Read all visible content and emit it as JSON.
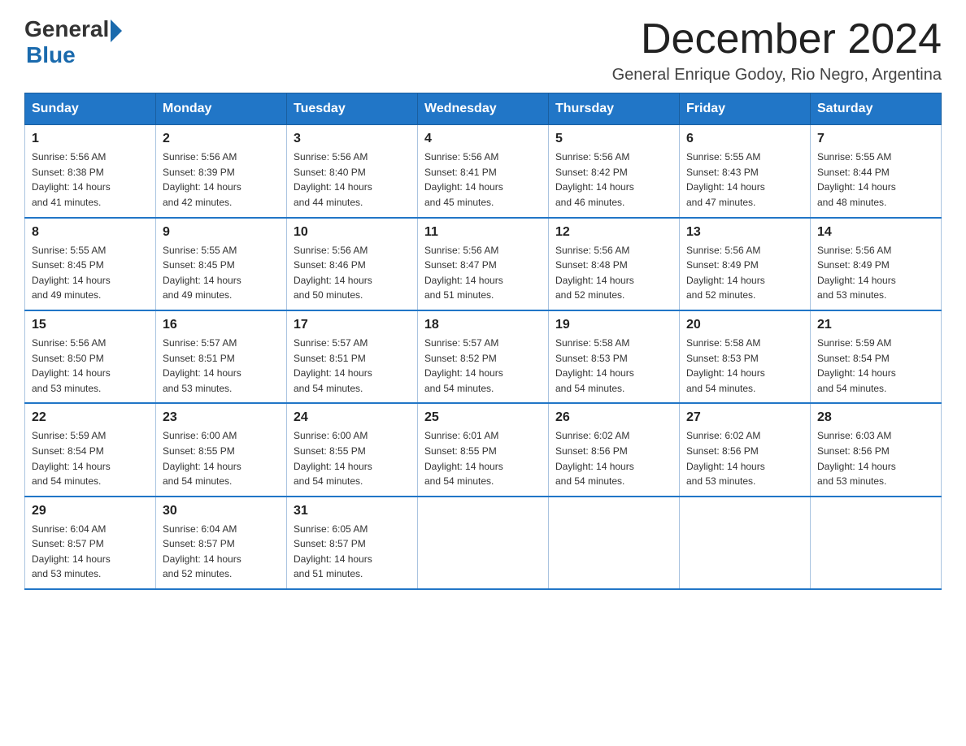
{
  "header": {
    "logo_general": "General",
    "logo_blue": "Blue",
    "month_title": "December 2024",
    "location": "General Enrique Godoy, Rio Negro, Argentina"
  },
  "columns": [
    "Sunday",
    "Monday",
    "Tuesday",
    "Wednesday",
    "Thursday",
    "Friday",
    "Saturday"
  ],
  "weeks": [
    [
      {
        "day": "1",
        "sunrise": "5:56 AM",
        "sunset": "8:38 PM",
        "daylight": "14 hours and 41 minutes."
      },
      {
        "day": "2",
        "sunrise": "5:56 AM",
        "sunset": "8:39 PM",
        "daylight": "14 hours and 42 minutes."
      },
      {
        "day": "3",
        "sunrise": "5:56 AM",
        "sunset": "8:40 PM",
        "daylight": "14 hours and 44 minutes."
      },
      {
        "day": "4",
        "sunrise": "5:56 AM",
        "sunset": "8:41 PM",
        "daylight": "14 hours and 45 minutes."
      },
      {
        "day": "5",
        "sunrise": "5:56 AM",
        "sunset": "8:42 PM",
        "daylight": "14 hours and 46 minutes."
      },
      {
        "day": "6",
        "sunrise": "5:55 AM",
        "sunset": "8:43 PM",
        "daylight": "14 hours and 47 minutes."
      },
      {
        "day": "7",
        "sunrise": "5:55 AM",
        "sunset": "8:44 PM",
        "daylight": "14 hours and 48 minutes."
      }
    ],
    [
      {
        "day": "8",
        "sunrise": "5:55 AM",
        "sunset": "8:45 PM",
        "daylight": "14 hours and 49 minutes."
      },
      {
        "day": "9",
        "sunrise": "5:55 AM",
        "sunset": "8:45 PM",
        "daylight": "14 hours and 49 minutes."
      },
      {
        "day": "10",
        "sunrise": "5:56 AM",
        "sunset": "8:46 PM",
        "daylight": "14 hours and 50 minutes."
      },
      {
        "day": "11",
        "sunrise": "5:56 AM",
        "sunset": "8:47 PM",
        "daylight": "14 hours and 51 minutes."
      },
      {
        "day": "12",
        "sunrise": "5:56 AM",
        "sunset": "8:48 PM",
        "daylight": "14 hours and 52 minutes."
      },
      {
        "day": "13",
        "sunrise": "5:56 AM",
        "sunset": "8:49 PM",
        "daylight": "14 hours and 52 minutes."
      },
      {
        "day": "14",
        "sunrise": "5:56 AM",
        "sunset": "8:49 PM",
        "daylight": "14 hours and 53 minutes."
      }
    ],
    [
      {
        "day": "15",
        "sunrise": "5:56 AM",
        "sunset": "8:50 PM",
        "daylight": "14 hours and 53 minutes."
      },
      {
        "day": "16",
        "sunrise": "5:57 AM",
        "sunset": "8:51 PM",
        "daylight": "14 hours and 53 minutes."
      },
      {
        "day": "17",
        "sunrise": "5:57 AM",
        "sunset": "8:51 PM",
        "daylight": "14 hours and 54 minutes."
      },
      {
        "day": "18",
        "sunrise": "5:57 AM",
        "sunset": "8:52 PM",
        "daylight": "14 hours and 54 minutes."
      },
      {
        "day": "19",
        "sunrise": "5:58 AM",
        "sunset": "8:53 PM",
        "daylight": "14 hours and 54 minutes."
      },
      {
        "day": "20",
        "sunrise": "5:58 AM",
        "sunset": "8:53 PM",
        "daylight": "14 hours and 54 minutes."
      },
      {
        "day": "21",
        "sunrise": "5:59 AM",
        "sunset": "8:54 PM",
        "daylight": "14 hours and 54 minutes."
      }
    ],
    [
      {
        "day": "22",
        "sunrise": "5:59 AM",
        "sunset": "8:54 PM",
        "daylight": "14 hours and 54 minutes."
      },
      {
        "day": "23",
        "sunrise": "6:00 AM",
        "sunset": "8:55 PM",
        "daylight": "14 hours and 54 minutes."
      },
      {
        "day": "24",
        "sunrise": "6:00 AM",
        "sunset": "8:55 PM",
        "daylight": "14 hours and 54 minutes."
      },
      {
        "day": "25",
        "sunrise": "6:01 AM",
        "sunset": "8:55 PM",
        "daylight": "14 hours and 54 minutes."
      },
      {
        "day": "26",
        "sunrise": "6:02 AM",
        "sunset": "8:56 PM",
        "daylight": "14 hours and 54 minutes."
      },
      {
        "day": "27",
        "sunrise": "6:02 AM",
        "sunset": "8:56 PM",
        "daylight": "14 hours and 53 minutes."
      },
      {
        "day": "28",
        "sunrise": "6:03 AM",
        "sunset": "8:56 PM",
        "daylight": "14 hours and 53 minutes."
      }
    ],
    [
      {
        "day": "29",
        "sunrise": "6:04 AM",
        "sunset": "8:57 PM",
        "daylight": "14 hours and 53 minutes."
      },
      {
        "day": "30",
        "sunrise": "6:04 AM",
        "sunset": "8:57 PM",
        "daylight": "14 hours and 52 minutes."
      },
      {
        "day": "31",
        "sunrise": "6:05 AM",
        "sunset": "8:57 PM",
        "daylight": "14 hours and 51 minutes."
      },
      null,
      null,
      null,
      null
    ]
  ],
  "labels": {
    "sunrise": "Sunrise:",
    "sunset": "Sunset:",
    "daylight": "Daylight:"
  }
}
